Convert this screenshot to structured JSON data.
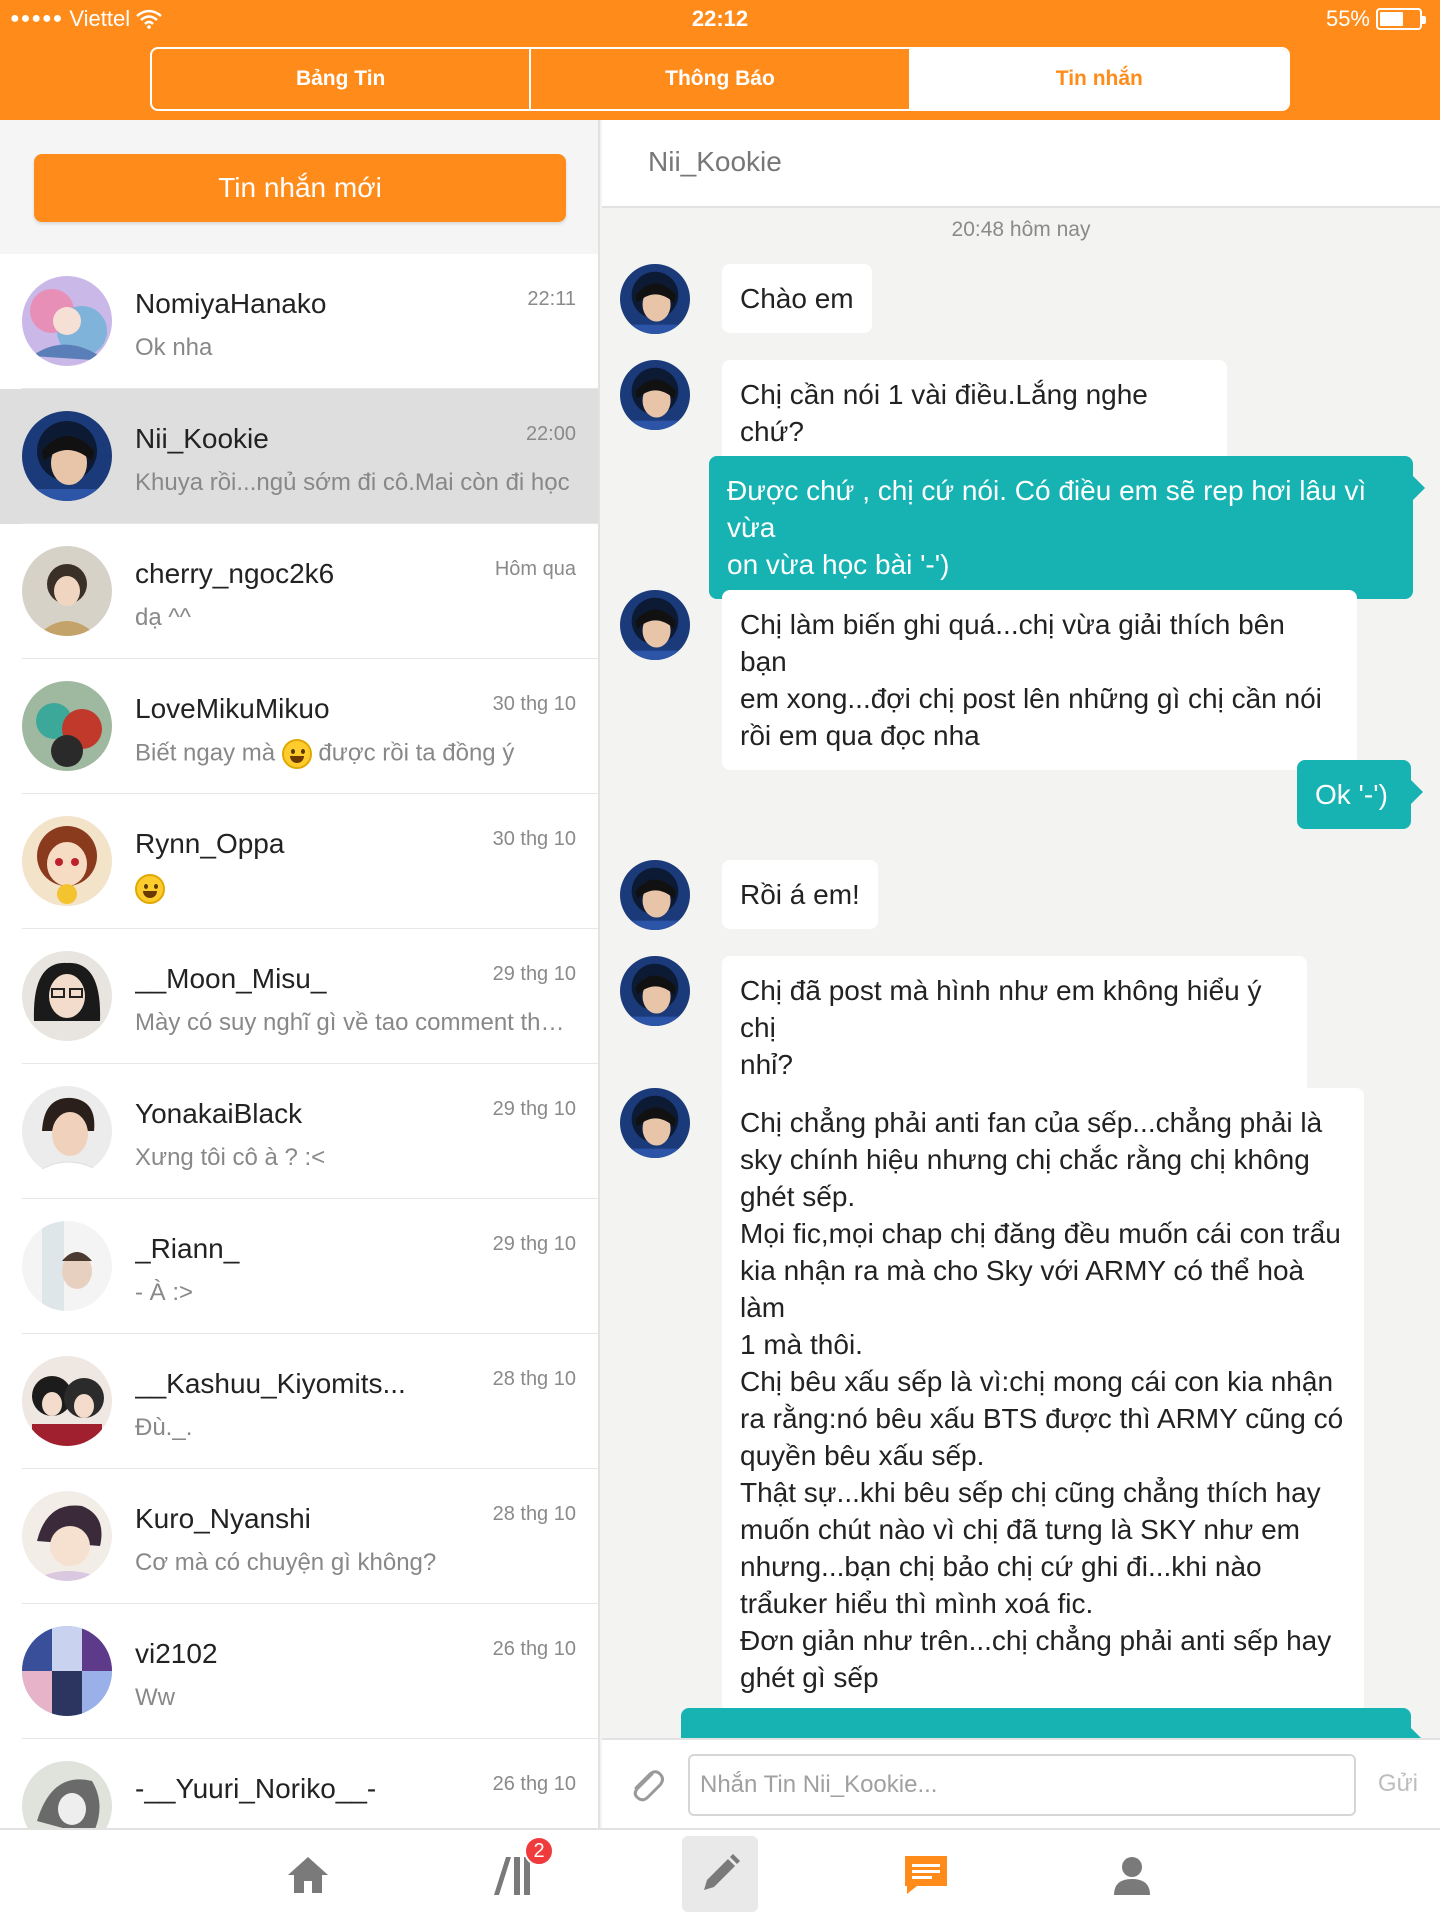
{
  "status_bar": {
    "carrier": "Viettel",
    "time": "22:12",
    "battery": "55%"
  },
  "tabs": [
    {
      "label": "Bảng Tin",
      "active": false
    },
    {
      "label": "Thông Báo",
      "active": false
    },
    {
      "label": "Tin nhắn",
      "active": true
    }
  ],
  "new_message_label": "Tin nhắn mới",
  "conversations": [
    {
      "name": "NomiyaHanako",
      "time": "22:11",
      "preview": "Ok nha"
    },
    {
      "name": "Nii_Kookie",
      "time": "22:00",
      "preview": "Khuya rồi...ngủ sớm đi cô.Mai còn đi học",
      "selected": true
    },
    {
      "name": "cherry_ngoc2k6",
      "time": "Hôm qua",
      "preview": "dạ ^^"
    },
    {
      "name": "LoveMikuMikuo",
      "time": "30 thg 10",
      "preview_before": "Biết ngay mà",
      "preview_after": "được rồi ta đồng ý"
    },
    {
      "name": "Rynn_Oppa",
      "time": "30 thg 10",
      "preview": ""
    },
    {
      "name": "__Moon_Misu_",
      "time": "29 thg 10",
      "preview": "Mày có suy nghĩ gì về tao comment thật không"
    },
    {
      "name": "YonakaiBlack",
      "time": "29 thg 10",
      "preview": "Xưng tôi cô à ? :<"
    },
    {
      "name": "_Riann_",
      "time": "29 thg 10",
      "preview": "- À :>"
    },
    {
      "name": "__Kashuu_Kiyomits...",
      "time": "28 thg 10",
      "preview": "Đù._."
    },
    {
      "name": "Kuro_Nyanshi",
      "time": "28 thg 10",
      "preview": "Cơ mà có chuyện gì không?"
    },
    {
      "name": "vi2102",
      "time": "26 thg 10",
      "preview": "Ww"
    },
    {
      "name": "-__Yuuri_Noriko__-",
      "time": "26 thg 10",
      "preview": ""
    }
  ],
  "chat": {
    "title": "Nii_Kookie",
    "date_label": "20:48 hôm nay",
    "messages": [
      {
        "dir": "in",
        "text": "Chào em"
      },
      {
        "dir": "in",
        "text": "Chị cần nói 1 vài điều.Lắng nghe chứ?"
      },
      {
        "dir": "out",
        "text": "Được chứ , chị cứ nói. Có điều em sẽ rep hơi lâu vì vừa\non vừa học bài '-')"
      },
      {
        "dir": "in",
        "text": "Chị làm biến ghi quá...chị vừa giải thích bên bạn\nem xong...đợi chị post lên những gì chị cần nói\nrồi em qua đọc nha"
      },
      {
        "dir": "out",
        "text": "Ok '-')"
      },
      {
        "dir": "in",
        "text": "Rồi á em!"
      },
      {
        "dir": "in",
        "text": "Chị đã post mà hình như em không hiểu ý chị\nnhỉ?"
      },
      {
        "dir": "in",
        "text": "Chị chẳng phải anti fan của sếp...chẳng phải là\nsky chính hiệu nhưng chị chắc rằng chị không\nghét sếp.\nMọi fic,mọi chap chị đăng đều muốn cái con trẩu\nkia nhận ra mà cho Sky với ARMY có thể hoà làm\n1 mà thôi.\nChị bêu xấu sếp là vì:chị mong cái con kia nhận\nra rằng:nó bêu xấu BTS được thì ARMY cũng có\nquyền bêu xấu sếp.\nThật sự...khi bêu sếp chị cũng chẳng thích hay\nmuốn chút nào vì chị đã tưng là SKY như em\nnhưng...bạn chị bảo chị cứ ghi đi...khi nào\ntrẩuker hiểu thì mình xoá fic.\nĐơn giản như trên...chị chẳng phải anti sếp hay\nghét gì sếp"
      },
      {
        "dir": "out",
        "text": ""
      }
    ]
  },
  "composer": {
    "placeholder": "Nhắn Tin Nii_Kookie...",
    "send_label": "Gửi"
  },
  "tabbar": {
    "items": [
      {
        "icon": "home-icon"
      },
      {
        "icon": "library-icon",
        "badge": "2"
      },
      {
        "icon": "pencil-icon"
      },
      {
        "icon": "messages-icon",
        "active": true
      },
      {
        "icon": "profile-icon"
      }
    ]
  },
  "colors": {
    "accent": "#ff8c1a",
    "outgoing_bubble": "#17b3b3",
    "badge": "#ef3b3b"
  }
}
